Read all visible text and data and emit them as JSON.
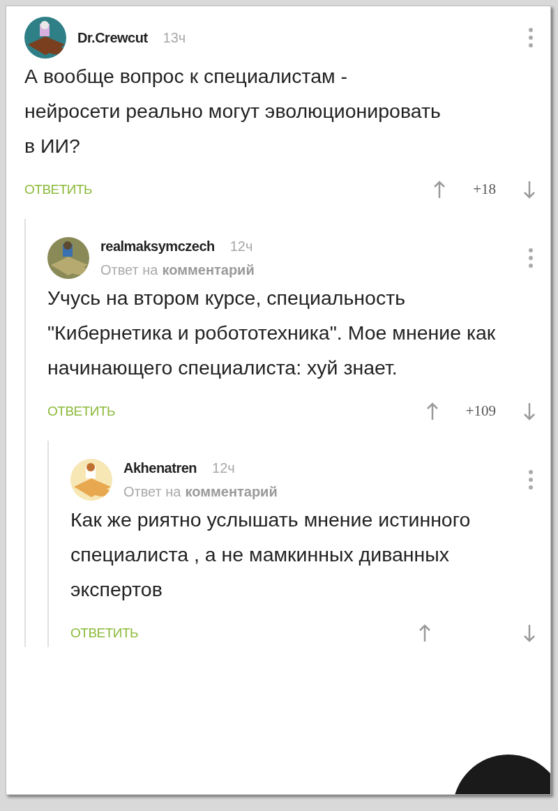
{
  "comments": [
    {
      "author": "Dr.Crewcut",
      "time": "13ч",
      "text": "А вообще вопрос к специалистам - нейросети реально могут эволюционировать в ИИ?",
      "reply_label": "ОТВЕТИТЬ",
      "score": "+18",
      "children": [
        {
          "author": "realmaksymczech",
          "time": "12ч",
          "reply_prefix": "Ответ на",
          "reply_target": "комментарий",
          "text": "Учусь на втором курсе, специальность \"Кибернетика и робототехника\". Мое мнение как начинающего специалиста: хуй знает.",
          "reply_label": "ОТВЕТИТЬ",
          "score": "+109",
          "children": [
            {
              "author": "Akhenatren",
              "time": "12ч",
              "reply_prefix": "Ответ на",
              "reply_target": "комментарий",
              "text": "Как же риятно услышать мнение истинного специалиста , а не мамкинных диванных экспертов",
              "reply_label": "ОТВЕТИТЬ"
            }
          ]
        }
      ]
    }
  ]
}
